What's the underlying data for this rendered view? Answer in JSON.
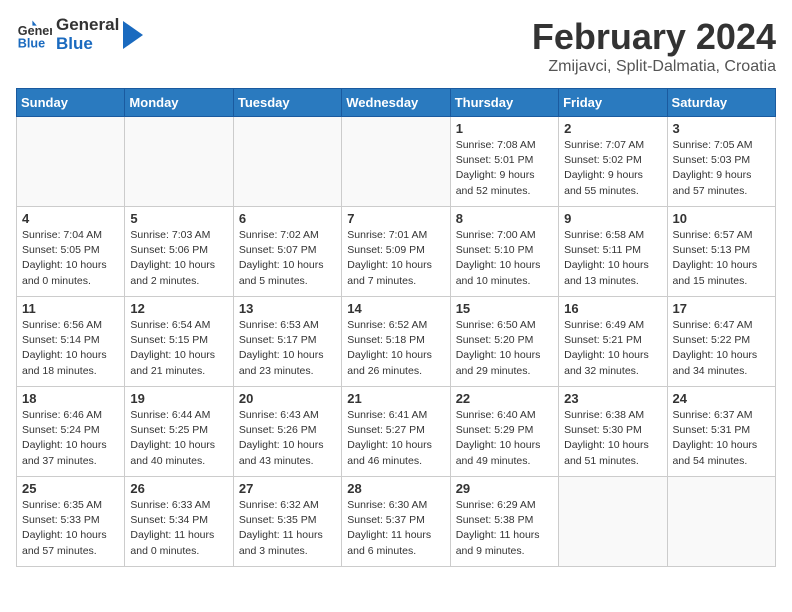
{
  "header": {
    "logo_line1": "General",
    "logo_line2": "Blue",
    "title": "February 2024",
    "subtitle": "Zmijavci, Split-Dalmatia, Croatia"
  },
  "weekdays": [
    "Sunday",
    "Monday",
    "Tuesday",
    "Wednesday",
    "Thursday",
    "Friday",
    "Saturday"
  ],
  "weeks": [
    [
      {
        "day": "",
        "info": ""
      },
      {
        "day": "",
        "info": ""
      },
      {
        "day": "",
        "info": ""
      },
      {
        "day": "",
        "info": ""
      },
      {
        "day": "1",
        "info": "Sunrise: 7:08 AM\nSunset: 5:01 PM\nDaylight: 9 hours\nand 52 minutes."
      },
      {
        "day": "2",
        "info": "Sunrise: 7:07 AM\nSunset: 5:02 PM\nDaylight: 9 hours\nand 55 minutes."
      },
      {
        "day": "3",
        "info": "Sunrise: 7:05 AM\nSunset: 5:03 PM\nDaylight: 9 hours\nand 57 minutes."
      }
    ],
    [
      {
        "day": "4",
        "info": "Sunrise: 7:04 AM\nSunset: 5:05 PM\nDaylight: 10 hours\nand 0 minutes."
      },
      {
        "day": "5",
        "info": "Sunrise: 7:03 AM\nSunset: 5:06 PM\nDaylight: 10 hours\nand 2 minutes."
      },
      {
        "day": "6",
        "info": "Sunrise: 7:02 AM\nSunset: 5:07 PM\nDaylight: 10 hours\nand 5 minutes."
      },
      {
        "day": "7",
        "info": "Sunrise: 7:01 AM\nSunset: 5:09 PM\nDaylight: 10 hours\nand 7 minutes."
      },
      {
        "day": "8",
        "info": "Sunrise: 7:00 AM\nSunset: 5:10 PM\nDaylight: 10 hours\nand 10 minutes."
      },
      {
        "day": "9",
        "info": "Sunrise: 6:58 AM\nSunset: 5:11 PM\nDaylight: 10 hours\nand 13 minutes."
      },
      {
        "day": "10",
        "info": "Sunrise: 6:57 AM\nSunset: 5:13 PM\nDaylight: 10 hours\nand 15 minutes."
      }
    ],
    [
      {
        "day": "11",
        "info": "Sunrise: 6:56 AM\nSunset: 5:14 PM\nDaylight: 10 hours\nand 18 minutes."
      },
      {
        "day": "12",
        "info": "Sunrise: 6:54 AM\nSunset: 5:15 PM\nDaylight: 10 hours\nand 21 minutes."
      },
      {
        "day": "13",
        "info": "Sunrise: 6:53 AM\nSunset: 5:17 PM\nDaylight: 10 hours\nand 23 minutes."
      },
      {
        "day": "14",
        "info": "Sunrise: 6:52 AM\nSunset: 5:18 PM\nDaylight: 10 hours\nand 26 minutes."
      },
      {
        "day": "15",
        "info": "Sunrise: 6:50 AM\nSunset: 5:20 PM\nDaylight: 10 hours\nand 29 minutes."
      },
      {
        "day": "16",
        "info": "Sunrise: 6:49 AM\nSunset: 5:21 PM\nDaylight: 10 hours\nand 32 minutes."
      },
      {
        "day": "17",
        "info": "Sunrise: 6:47 AM\nSunset: 5:22 PM\nDaylight: 10 hours\nand 34 minutes."
      }
    ],
    [
      {
        "day": "18",
        "info": "Sunrise: 6:46 AM\nSunset: 5:24 PM\nDaylight: 10 hours\nand 37 minutes."
      },
      {
        "day": "19",
        "info": "Sunrise: 6:44 AM\nSunset: 5:25 PM\nDaylight: 10 hours\nand 40 minutes."
      },
      {
        "day": "20",
        "info": "Sunrise: 6:43 AM\nSunset: 5:26 PM\nDaylight: 10 hours\nand 43 minutes."
      },
      {
        "day": "21",
        "info": "Sunrise: 6:41 AM\nSunset: 5:27 PM\nDaylight: 10 hours\nand 46 minutes."
      },
      {
        "day": "22",
        "info": "Sunrise: 6:40 AM\nSunset: 5:29 PM\nDaylight: 10 hours\nand 49 minutes."
      },
      {
        "day": "23",
        "info": "Sunrise: 6:38 AM\nSunset: 5:30 PM\nDaylight: 10 hours\nand 51 minutes."
      },
      {
        "day": "24",
        "info": "Sunrise: 6:37 AM\nSunset: 5:31 PM\nDaylight: 10 hours\nand 54 minutes."
      }
    ],
    [
      {
        "day": "25",
        "info": "Sunrise: 6:35 AM\nSunset: 5:33 PM\nDaylight: 10 hours\nand 57 minutes."
      },
      {
        "day": "26",
        "info": "Sunrise: 6:33 AM\nSunset: 5:34 PM\nDaylight: 11 hours\nand 0 minutes."
      },
      {
        "day": "27",
        "info": "Sunrise: 6:32 AM\nSunset: 5:35 PM\nDaylight: 11 hours\nand 3 minutes."
      },
      {
        "day": "28",
        "info": "Sunrise: 6:30 AM\nSunset: 5:37 PM\nDaylight: 11 hours\nand 6 minutes."
      },
      {
        "day": "29",
        "info": "Sunrise: 6:29 AM\nSunset: 5:38 PM\nDaylight: 11 hours\nand 9 minutes."
      },
      {
        "day": "",
        "info": ""
      },
      {
        "day": "",
        "info": ""
      }
    ]
  ]
}
